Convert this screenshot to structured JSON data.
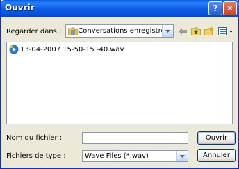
{
  "window": {
    "title": "Ouvrir",
    "help_icon": "question-mark-icon",
    "close_icon": "close-icon"
  },
  "lookin": {
    "label": "Regarder dans :",
    "value": "Conversations enregistrées",
    "icons": [
      "back-arrow-icon",
      "up-folder-icon",
      "new-folder-icon",
      "view-menu-icon"
    ]
  },
  "files": [
    {
      "name": "13-04-2007 15-50-15 -40.wav",
      "icon": "wav-file-icon"
    }
  ],
  "filename": {
    "label": "Nom du fichier :",
    "value": ""
  },
  "filetype": {
    "label": "Fichiers de type :",
    "value": "Wave Files (*.wav)"
  },
  "buttons": {
    "open": "Ouvrir",
    "cancel": "Annuler"
  },
  "colors": {
    "titlebar": "#0654e0",
    "dialog_bg": "#ece9d8",
    "field_border": "#7f9db9"
  }
}
